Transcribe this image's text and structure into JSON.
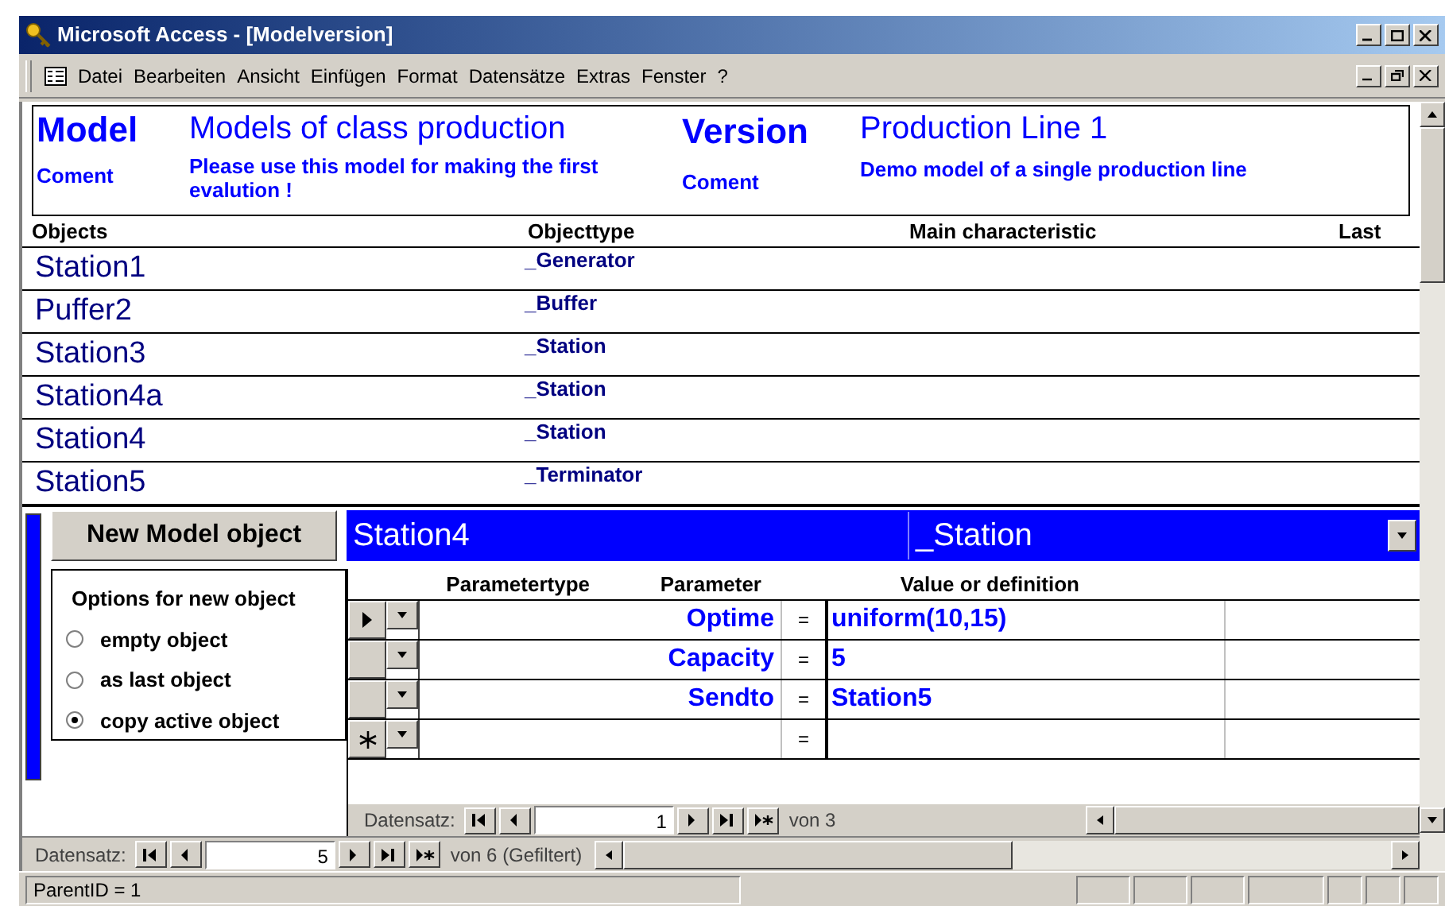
{
  "window": {
    "title": "Microsoft Access - [Modelversion]"
  },
  "menu": [
    "Datei",
    "Bearbeiten",
    "Ansicht",
    "Einfügen",
    "Format",
    "Datensätze",
    "Extras",
    "Fenster",
    "?"
  ],
  "header": {
    "model_label": "Model",
    "model_name": "Models of class production",
    "model_comment_label": "Coment",
    "model_comment": "Please use this model for making the first evalution !",
    "version_label": "Version",
    "version_name": "Production Line 1",
    "version_comment_label": "Coment",
    "version_comment": "Demo model of a single production line"
  },
  "objects": {
    "columns": [
      "Objects",
      "Objecttype",
      "Main characteristic",
      "Last"
    ],
    "rows": [
      {
        "name": "Station1",
        "type": "_Generator"
      },
      {
        "name": "Puffer2",
        "type": "_Buffer"
      },
      {
        "name": "Station3",
        "type": "_Station"
      },
      {
        "name": "Station4a",
        "type": "_Station"
      },
      {
        "name": "Station4",
        "type": "_Station"
      },
      {
        "name": "Station5",
        "type": "_Terminator"
      }
    ]
  },
  "new_object_button": "New Model object",
  "current_object": {
    "name": "Station4",
    "type": "_Station"
  },
  "options": {
    "title": "Options for new object",
    "items": [
      {
        "label": "empty object",
        "selected": false
      },
      {
        "label": "as last object",
        "selected": false
      },
      {
        "label": "copy active object",
        "selected": true
      }
    ]
  },
  "parameters": {
    "columns": [
      "Parametertype",
      "Parameter",
      "Value or definition"
    ],
    "rows": [
      {
        "kind": "current",
        "parameter": "Optime",
        "equals": "=",
        "value": "uniform(10,15)"
      },
      {
        "kind": "normal",
        "parameter": "Capacity",
        "equals": "=",
        "value": "5"
      },
      {
        "kind": "normal",
        "parameter": "Sendto",
        "equals": "=",
        "value": "Station5"
      },
      {
        "kind": "new",
        "equals": "="
      }
    ],
    "navigator": {
      "label": "Datensatz:",
      "current": "1",
      "total": "von 3"
    }
  },
  "navigator": {
    "label": "Datensatz:",
    "current": "5",
    "total": "von 6 (Gefiltert)"
  },
  "status_bar": "ParentID = 1"
}
